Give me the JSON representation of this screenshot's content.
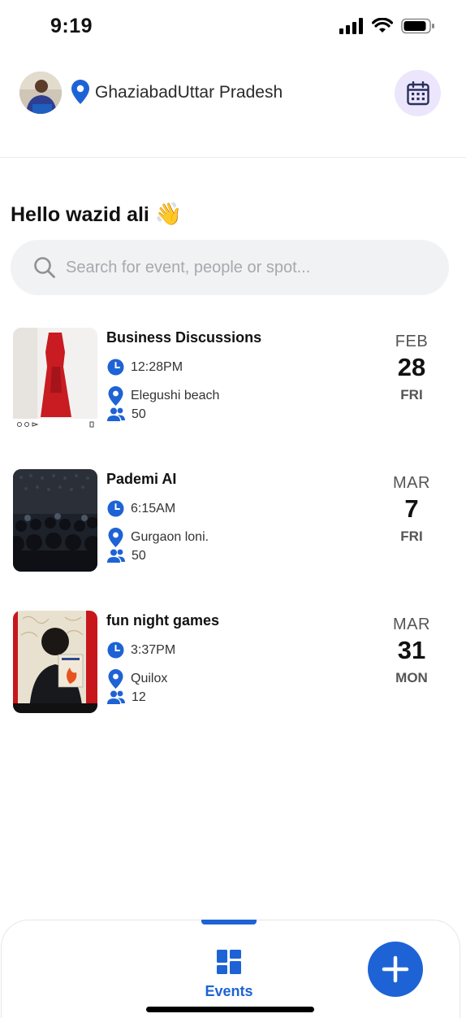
{
  "status_bar": {
    "time": "9:19"
  },
  "header": {
    "location": "GhaziabadUttar Pradesh"
  },
  "greeting": {
    "text": "Hello wazid ali",
    "emoji": "👋"
  },
  "search": {
    "placeholder": "Search for event, people or spot..."
  },
  "events": [
    {
      "title": "Business Discussions",
      "time": "12:28PM",
      "place": "Elegushi beach",
      "attendees": "50",
      "month": "FEB",
      "day": "28",
      "weekday": "FRI"
    },
    {
      "title": "Pademi AI",
      "time": "6:15AM",
      "place": "Gurgaon loni.",
      "attendees": "50",
      "month": "MAR",
      "day": "7",
      "weekday": "FRI"
    },
    {
      "title": "fun night games",
      "time": "3:37PM",
      "place": "Quilox",
      "attendees": "12",
      "month": "MAR",
      "day": "31",
      "weekday": "MON"
    }
  ],
  "bottom_nav": {
    "events_label": "Events"
  },
  "colors": {
    "accent": "#1e63d6",
    "calendar_bg": "#ebe6fb",
    "search_bg": "#f1f2f4"
  },
  "icons": [
    "signal-icon",
    "wifi-icon",
    "battery-icon",
    "location-pin-icon",
    "calendar-icon",
    "search-icon",
    "clock-icon",
    "people-icon",
    "grid-icon",
    "plus-icon"
  ]
}
